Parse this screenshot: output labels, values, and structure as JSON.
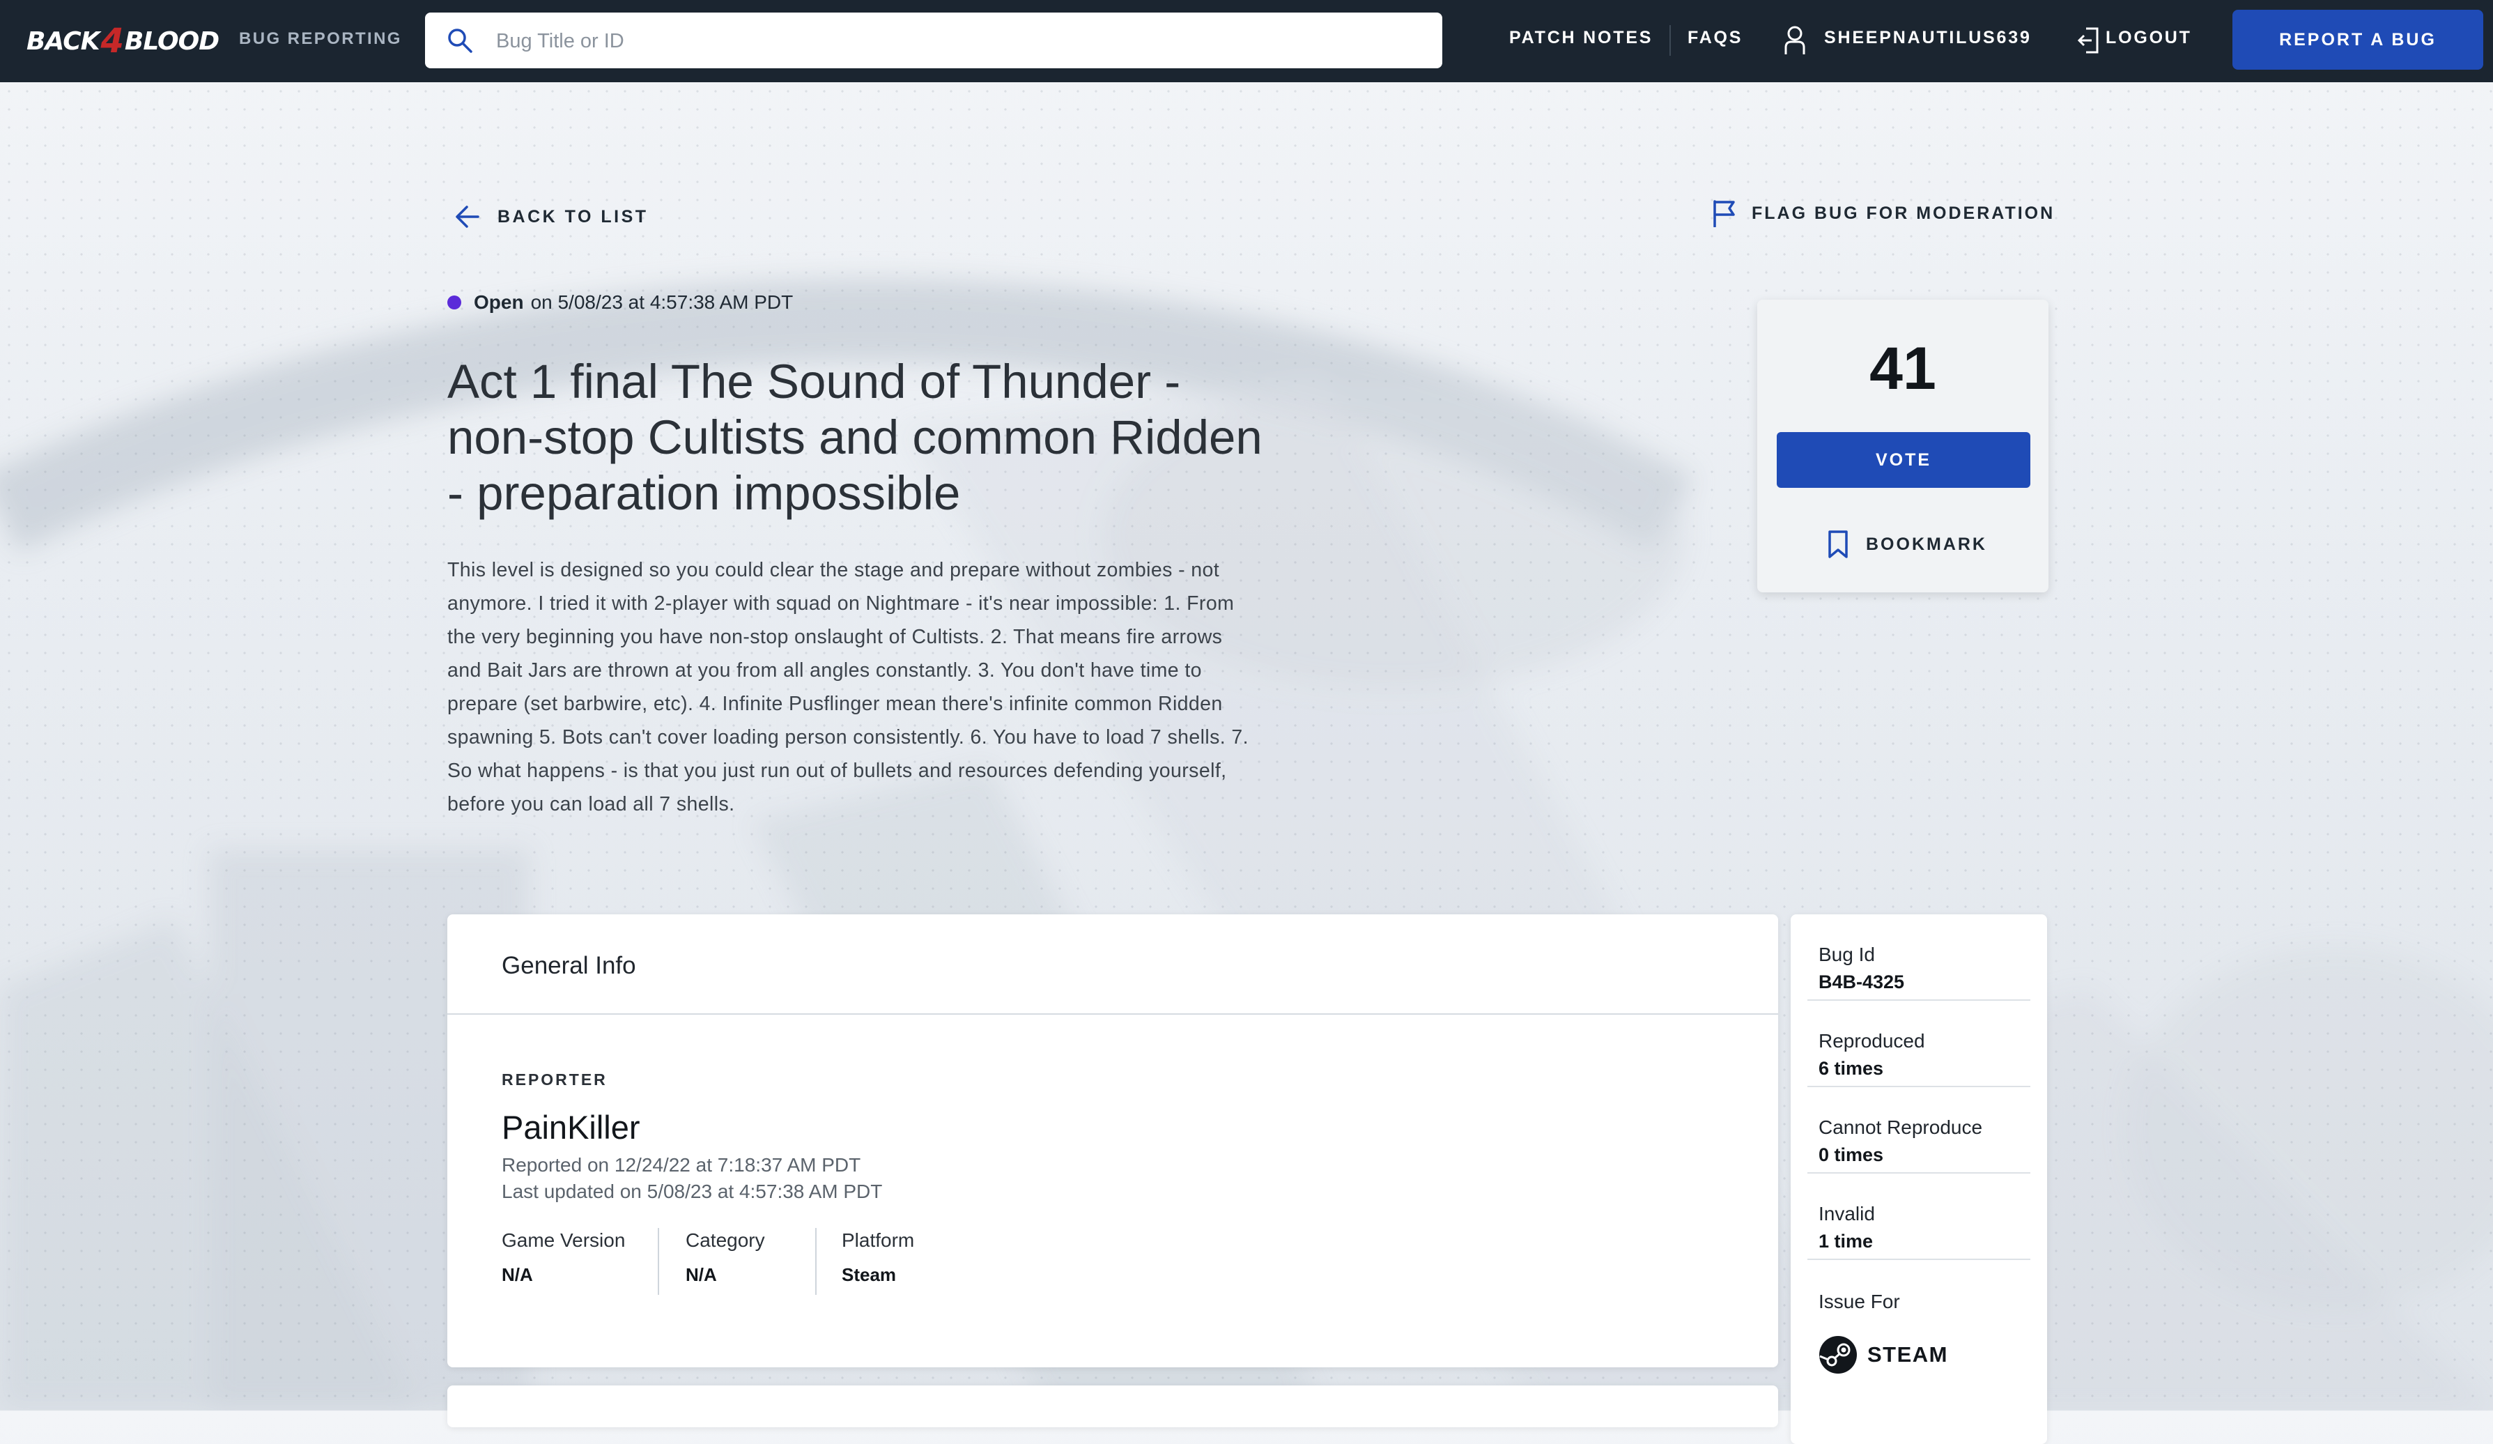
{
  "header": {
    "logo_text": "BACK4BLOOD",
    "logo_left": "BACK",
    "logo_four": "4",
    "logo_right": "BLOOD",
    "section": "BUG REPORTING",
    "search_placeholder": "Bug Title or ID",
    "search_value": "",
    "nav": {
      "patch_notes": "PATCH NOTES",
      "faqs": "FAQS",
      "username": "SHEEPNAUTILUS639",
      "logout": "LOGOUT",
      "report_bug": "REPORT A BUG"
    }
  },
  "actions": {
    "back": "BACK TO LIST",
    "flag": "FLAG BUG FOR MODERATION"
  },
  "bug": {
    "status": "Open",
    "status_date": "on 5/08/23 at 4:57:38 AM PDT",
    "status_color": "#5b2bd9",
    "title": "Act 1 final The Sound of Thunder - non-stop Cultists and common Ridden - preparation impossible",
    "description": "This level is designed so you could clear the stage and prepare without zombies - not anymore. I tried it with 2-player with squad on Nightmare - it's near impossible: 1. From the very beginning you have non-stop onslaught of Cultists. 2. That means fire arrows and Bait Jars are thrown at you from all angles constantly. 3. You don't have time to prepare (set barbwire, etc). 4. Infinite Pusflinger mean there's infinite common Ridden spawning 5. Bots can't cover loading person consistently. 6. You have to load 7 shells. 7. So what happens - is that you just run out of bullets and resources defending yourself, before you can load all 7 shells."
  },
  "vote": {
    "count": "41",
    "vote_label": "VOTE",
    "bookmark_label": "BOOKMARK"
  },
  "general_info": {
    "heading": "General Info",
    "reporter_label": "REPORTER",
    "reporter_name": "PainKiller",
    "reported_on": "Reported on 12/24/22 at 7:18:37 AM PDT",
    "last_updated": "Last updated on 5/08/23 at 4:57:38 AM PDT",
    "game_version_label": "Game Version",
    "game_version": "N/A",
    "category_label": "Category",
    "category": "N/A",
    "platform_label": "Platform",
    "platform": "Steam"
  },
  "side_info": {
    "items": [
      {
        "label": "Bug Id",
        "value": "B4B-4325"
      },
      {
        "label": "Reproduced",
        "value": "6 times"
      },
      {
        "label": "Cannot Reproduce",
        "value": "0 times"
      },
      {
        "label": "Invalid",
        "value": "1 time"
      }
    ],
    "issue_for_label": "Issue For",
    "issue_for_platform": "STEAM"
  },
  "icons": {
    "search": "search-icon",
    "user": "user-icon",
    "logout": "logout-icon",
    "back": "arrow-left-icon",
    "flag": "flag-icon",
    "bookmark": "bookmark-icon",
    "steam": "steam-icon"
  },
  "colors": {
    "accent": "#1f4bb6",
    "topbar": "#1b2530",
    "logo_four": "#c62828"
  }
}
